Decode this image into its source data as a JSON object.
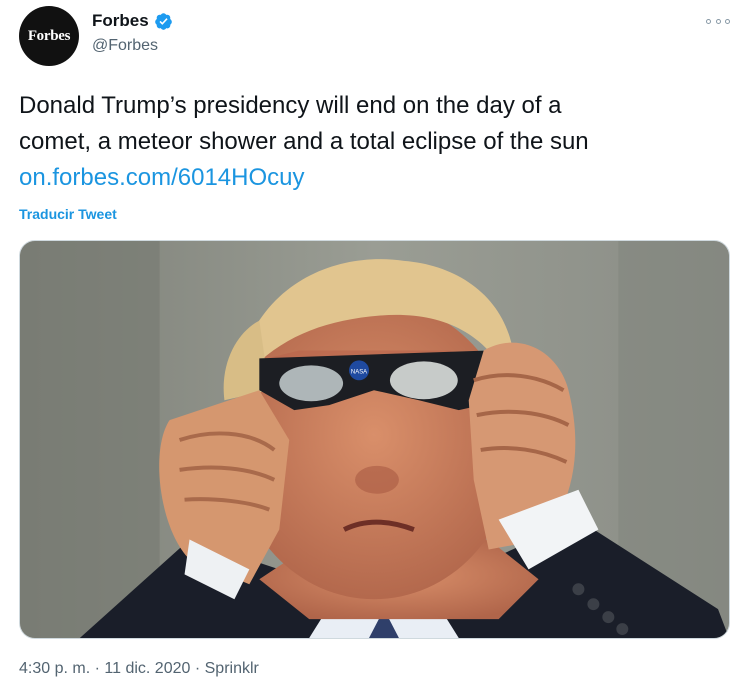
{
  "author": {
    "avatar_text": "Forbes",
    "display_name": "Forbes",
    "handle": "@Forbes",
    "verified_icon": "verified-badge-icon"
  },
  "tweet": {
    "line1": "Donald Trump’s presidency will end on the day of a",
    "line2": "comet, a meteor shower and a total eclipse of the sun",
    "link": "on.forbes.com/6014HOcuy",
    "translate_label": "Traducir Tweet"
  },
  "media": {
    "glasses_logo_text": "NASA"
  },
  "meta": {
    "time": "4:30 p. m.",
    "sep1": "·",
    "date": "11 dic. 2020",
    "sep2": "·",
    "source": "Sprinklr"
  },
  "colors": {
    "link": "#1b95e0",
    "verified": "#1d9bf0",
    "secondary_text": "#536471"
  }
}
